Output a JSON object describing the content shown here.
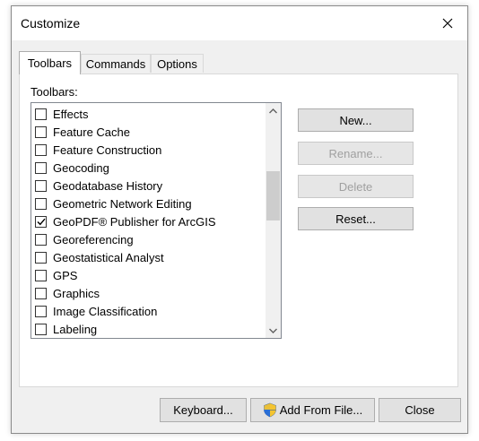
{
  "window": {
    "title": "Customize"
  },
  "tabs": [
    {
      "label": "Toolbars",
      "active": true
    },
    {
      "label": "Commands",
      "active": false
    },
    {
      "label": "Options",
      "active": false
    }
  ],
  "toolbars_panel": {
    "label": "Toolbars:",
    "items": [
      {
        "label": "Effects",
        "checked": false
      },
      {
        "label": "Feature Cache",
        "checked": false
      },
      {
        "label": "Feature Construction",
        "checked": false
      },
      {
        "label": "Geocoding",
        "checked": false
      },
      {
        "label": "Geodatabase History",
        "checked": false
      },
      {
        "label": "Geometric Network Editing",
        "checked": false
      },
      {
        "label": "GeoPDF® Publisher for ArcGIS",
        "checked": true
      },
      {
        "label": "Georeferencing",
        "checked": false
      },
      {
        "label": "Geostatistical Analyst",
        "checked": false
      },
      {
        "label": "GPS",
        "checked": false
      },
      {
        "label": "Graphics",
        "checked": false
      },
      {
        "label": "Image Classification",
        "checked": false
      },
      {
        "label": "Labeling",
        "checked": false
      }
    ]
  },
  "side_buttons": {
    "new": "New...",
    "rename": "Rename...",
    "delete": "Delete",
    "reset": "Reset..."
  },
  "bottom_buttons": {
    "keyboard": "Keyboard...",
    "add_from_file": "Add From File...",
    "close": "Close"
  },
  "icons": {
    "close": "close-icon",
    "scroll_up": "chevron-up-icon",
    "scroll_down": "chevron-down-icon",
    "uac_shield": "shield-icon"
  },
  "colors": {
    "dialog_bg": "#f0f0f0",
    "panel_bg": "#ffffff",
    "button_bg": "#e1e1e1",
    "disabled_text": "#a0a0a0"
  }
}
